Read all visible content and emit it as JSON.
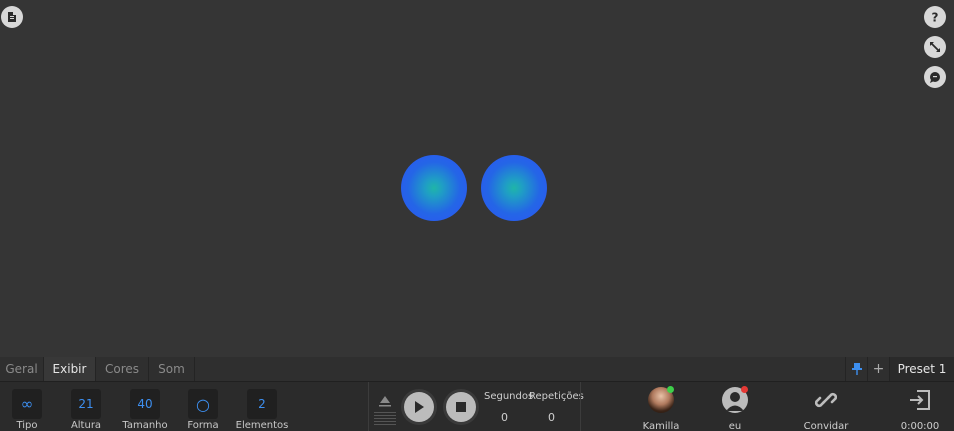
{
  "tabs": [
    {
      "label": "Geral"
    },
    {
      "label": "Exibir"
    },
    {
      "label": "Cores"
    },
    {
      "label": "Som"
    }
  ],
  "active_tab": "Exibir",
  "preset": {
    "label": "Preset 1"
  },
  "params": [
    {
      "value": "∞",
      "label": "Tipo"
    },
    {
      "value": "21",
      "label": "Altura"
    },
    {
      "value": "40",
      "label": "Tamanho"
    },
    {
      "value": "○",
      "label": "Forma"
    },
    {
      "value": "2",
      "label": "Elementos"
    }
  ],
  "counters": {
    "seconds_label": "Segundos",
    "seconds_value": "0",
    "reps_label": "Repetições",
    "reps_value": "0"
  },
  "users": [
    {
      "name": "Kamilla",
      "status_color": "#3ecf4a"
    },
    {
      "name": "eu",
      "status_color": "#e53935"
    }
  ],
  "invite": {
    "label": "Convidar cliente"
  },
  "session": {
    "time": "0:00:00"
  },
  "colors": {
    "accent": "#3d8ff0",
    "ball_outer": "#2d52f7",
    "ball_inner": "#1fb5a8"
  },
  "icons": [
    "document-icon",
    "help-icon",
    "fullscreen-icon",
    "chat-icon",
    "pin-icon",
    "plus-icon",
    "eject-icon",
    "play-icon",
    "stop-icon",
    "link-icon",
    "exit-icon"
  ]
}
